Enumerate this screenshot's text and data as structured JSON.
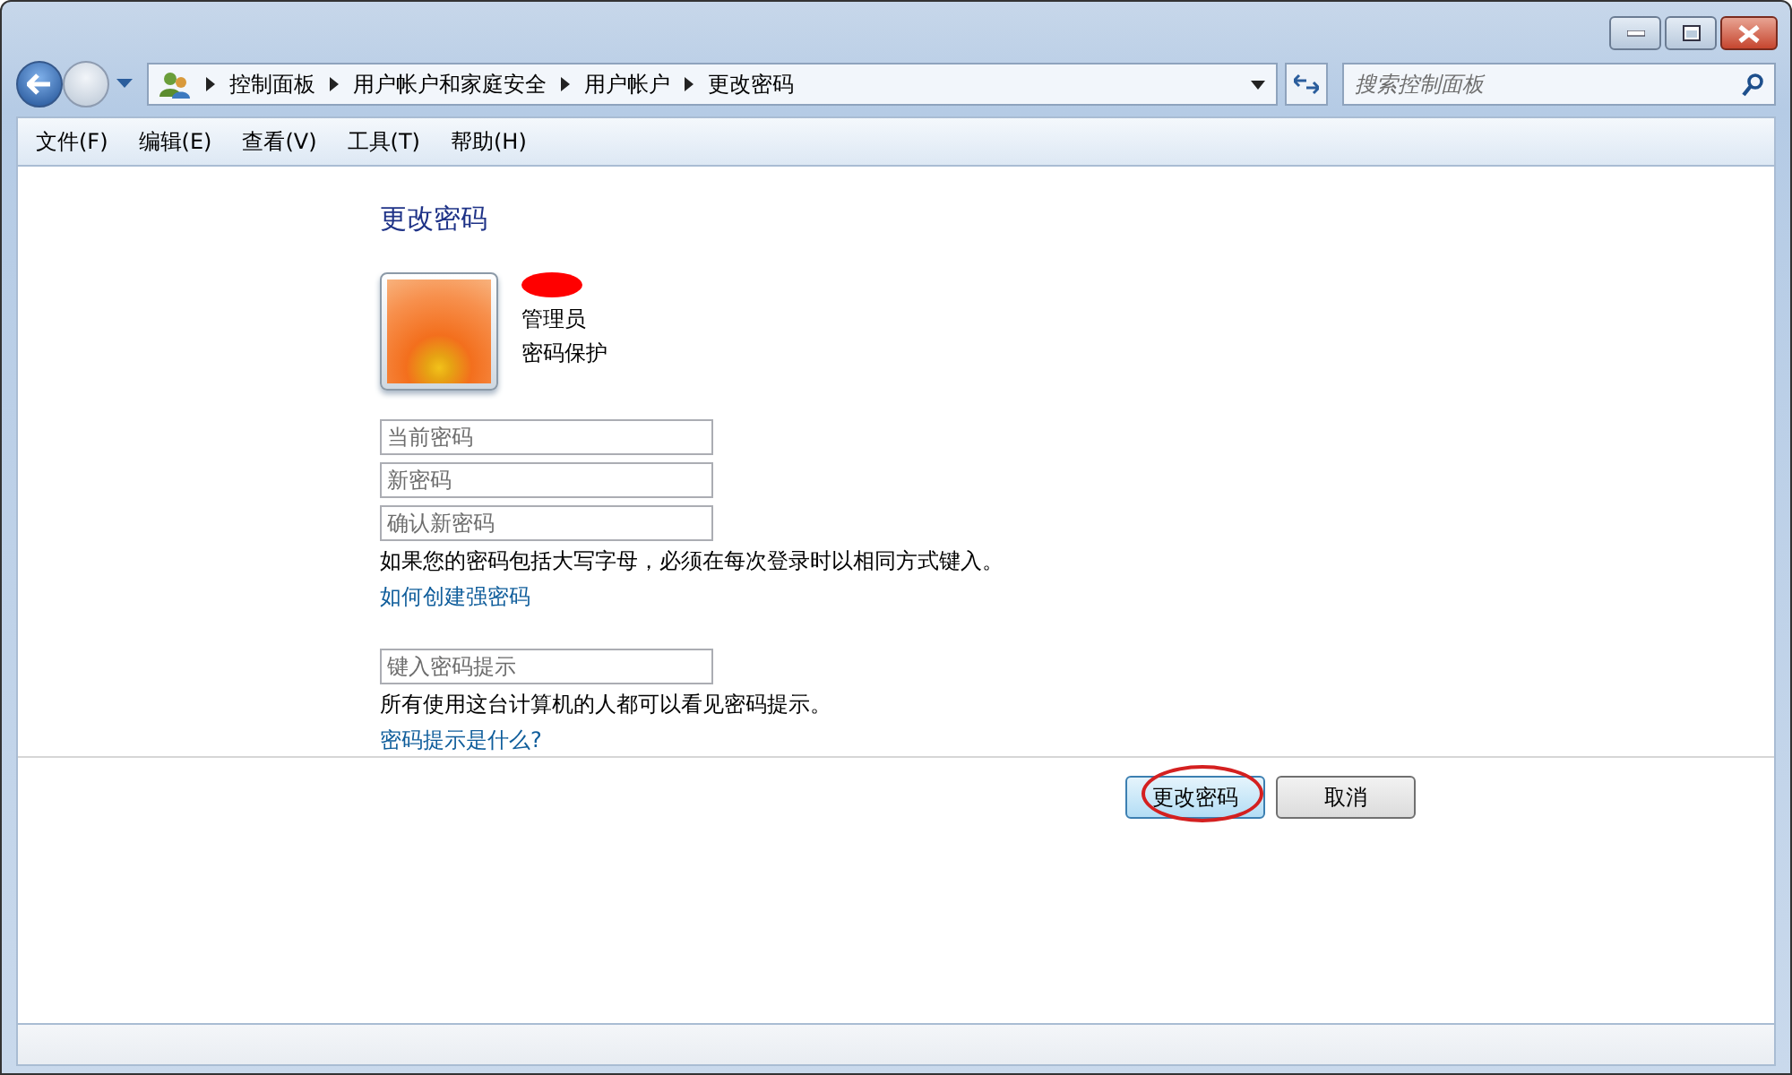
{
  "breadcrumb": [
    "控制面板",
    "用户帐户和家庭安全",
    "用户帐户",
    "更改密码"
  ],
  "search": {
    "placeholder": "搜索控制面板"
  },
  "menu": [
    "文件(F)",
    "编辑(E)",
    "查看(V)",
    "工具(T)",
    "帮助(H)"
  ],
  "page_title": "更改密码",
  "account": {
    "role": "管理员",
    "status": "密码保护"
  },
  "password_fields": [
    {
      "placeholder": "当前密码"
    },
    {
      "placeholder": "新密码"
    },
    {
      "placeholder": "确认新密码"
    }
  ],
  "case_note": "如果您的密码包括大写字母，必须在每次登录时以相同方式键入。",
  "strong_link": "如何创建强密码",
  "hint_field": {
    "placeholder": "键入密码提示"
  },
  "hint_note": "所有使用这台计算机的人都可以看见密码提示。",
  "hint_link": "密码提示是什么?",
  "buttons": [
    {
      "label": "更改密码",
      "default": true,
      "circled": true
    },
    {
      "label": "取消",
      "default": false,
      "circled": false
    }
  ]
}
